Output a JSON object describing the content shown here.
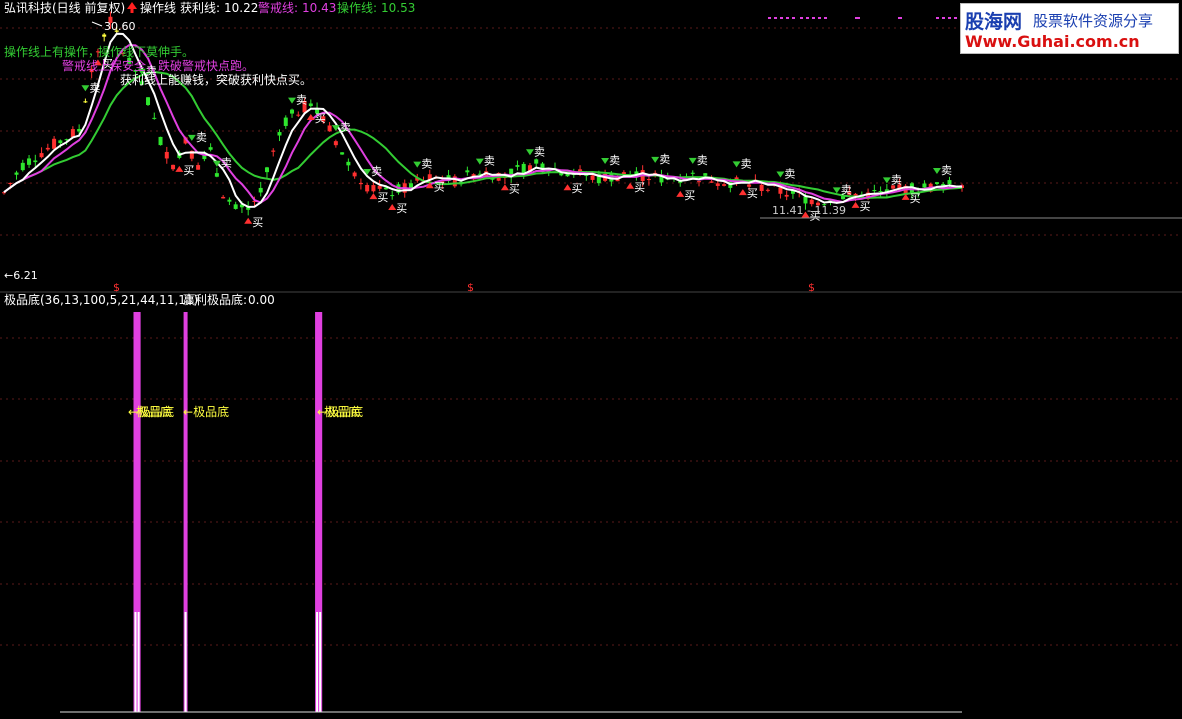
{
  "header": {
    "stock_title": "弘讯科技(日线 前复权)",
    "arrow_icon": "red-up-arrow-icon",
    "op_line_name": "操作线",
    "profit_label": "获利线:",
    "profit_value": "10.22",
    "warn_label": "警戒线:",
    "warn_value": "10.43",
    "op_label": "操作线:",
    "op_value": "10.53"
  },
  "annotations": {
    "line1_a": "操作线上有操作，",
    "line1_b": "操作线下莫伸手。",
    "line2": "警戒线上保安全，跌破警戒快点跑。",
    "line3": "获利线上能赚钱，突破获利快点买。",
    "high_label": "30.60",
    "low_label": "6.21",
    "range_label": "11.41 - 11.39",
    "sell": "卖",
    "buy": "买",
    "dollar": "$"
  },
  "indicator": {
    "title": "极品底(36,13,100,5,21,44,11,11)",
    "sub_label": "赢利极品底:",
    "sub_value": "0.00",
    "signal_text": "极品底"
  },
  "logo": {
    "cn": "股海网",
    "slogan": "股票软件资源分享",
    "url": "Www.Guhai.com.cn"
  },
  "colors": {
    "background": "#000000",
    "up_candle": "#ff3030",
    "down_candle": "#2ee62e",
    "profit_line": "#ffffff",
    "warn_line": "#e040e0",
    "op_line": "#33cc33",
    "signal_bar": "#e040e0",
    "yellow": "#ffff40"
  },
  "chart_data": [
    {
      "type": "line",
      "title": "弘讯科技(日线 前复权)",
      "series": [
        {
          "name": "获利线",
          "last": 10.22
        },
        {
          "name": "警戒线",
          "last": 10.43
        },
        {
          "name": "操作线",
          "last": 10.53
        }
      ],
      "y_marks": {
        "high": 30.6,
        "low": 6.21
      },
      "price_path": [
        [
          0,
          10
        ],
        [
          3,
          12
        ],
        [
          6,
          13
        ],
        [
          9,
          14
        ],
        [
          12,
          15
        ],
        [
          14,
          22
        ],
        [
          16,
          28
        ],
        [
          17,
          30.6
        ],
        [
          19,
          25
        ],
        [
          21,
          22
        ],
        [
          23,
          18
        ],
        [
          25,
          14
        ],
        [
          27,
          12
        ],
        [
          29,
          14
        ],
        [
          31,
          12
        ],
        [
          33,
          13
        ],
        [
          35,
          10
        ],
        [
          37,
          9
        ],
        [
          39,
          9
        ],
        [
          41,
          10
        ],
        [
          43,
          13
        ],
        [
          45,
          16
        ],
        [
          47,
          17
        ],
        [
          49,
          18
        ],
        [
          51,
          16
        ],
        [
          53,
          14
        ],
        [
          55,
          12
        ],
        [
          58,
          10.5
        ],
        [
          61,
          10
        ],
        [
          64,
          10.3
        ],
        [
          68,
          11
        ],
        [
          72,
          10.8
        ],
        [
          76,
          11.5
        ],
        [
          80,
          11.2
        ],
        [
          85,
          12
        ],
        [
          90,
          11.5
        ],
        [
          95,
          11
        ],
        [
          100,
          11.3
        ],
        [
          105,
          11
        ],
        [
          110,
          11.2
        ],
        [
          115,
          10.8
        ],
        [
          120,
          10.5
        ],
        [
          125,
          10
        ],
        [
          130,
          9.5
        ],
        [
          135,
          9.8
        ],
        [
          140,
          10
        ],
        [
          145,
          10.3
        ],
        [
          150,
          10.5
        ],
        [
          153,
          10.6
        ]
      ],
      "ylim": [
        6,
        31
      ]
    },
    {
      "type": "bar",
      "title": "极品底(36,13,100,5,21,44,11,11)",
      "series": [
        {
          "name": "赢利极品底",
          "last": 0.0
        }
      ],
      "signals": [
        {
          "x": 21
        },
        {
          "x": 21.5
        },
        {
          "x": 29
        },
        {
          "x": 50
        },
        {
          "x": 50.5
        }
      ]
    }
  ]
}
